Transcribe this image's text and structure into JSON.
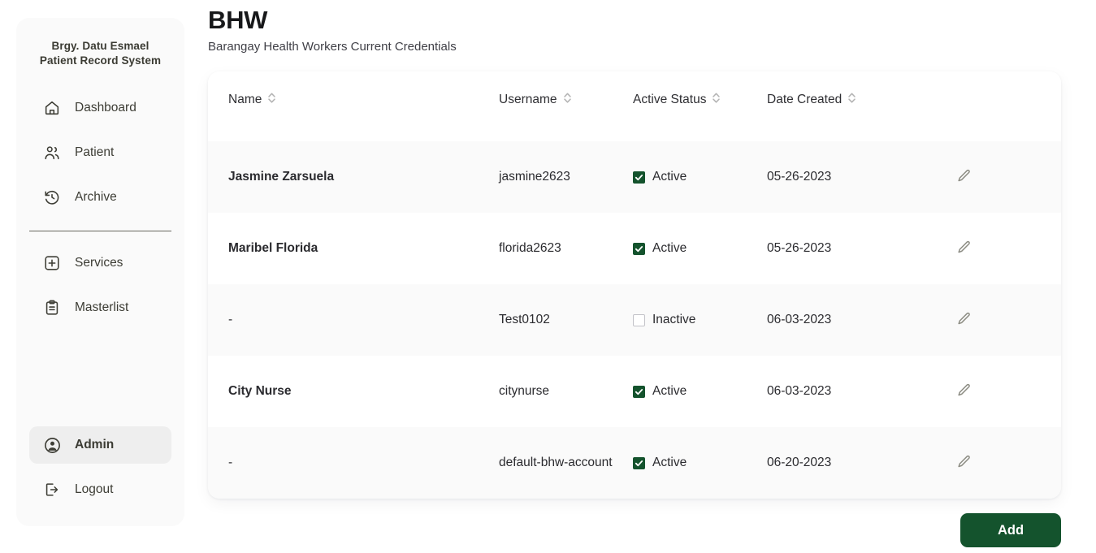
{
  "sidebar": {
    "brand_line1": "Brgy. Datu Esmael",
    "brand_line2": "Patient Record System",
    "top_items": [
      {
        "label": "Dashboard",
        "icon": "home-icon"
      },
      {
        "label": "Patient",
        "icon": "users-icon"
      },
      {
        "label": "Archive",
        "icon": "history-icon"
      }
    ],
    "mid_items": [
      {
        "label": "Services",
        "icon": "medical-cross-icon"
      },
      {
        "label": "Masterlist",
        "icon": "clipboard-icon"
      }
    ],
    "bottom_items": [
      {
        "label": "Admin",
        "icon": "account-circle-icon",
        "active": true
      },
      {
        "label": "Logout",
        "icon": "logout-icon",
        "active": false
      }
    ]
  },
  "header": {
    "title": "BHW",
    "subtitle": "Barangay Health Workers Current Credentials"
  },
  "table": {
    "columns": [
      {
        "label": "Name",
        "sortable": true
      },
      {
        "label": "Username",
        "sortable": true
      },
      {
        "label": "Active Status",
        "sortable": true
      },
      {
        "label": "Date Created",
        "sortable": true
      }
    ],
    "rows": [
      {
        "name": "Jasmine Zarsuela",
        "username": "jasmine2623",
        "status_label": "Active",
        "status_checked": true,
        "date_created": "05-26-2023",
        "action_icon": "pencil-icon"
      },
      {
        "name": "Maribel Florida",
        "username": "florida2623",
        "status_label": "Active",
        "status_checked": true,
        "date_created": "05-26-2023",
        "action_icon": "pencil-icon"
      },
      {
        "name": "-",
        "username": "Test0102",
        "status_label": "Inactive",
        "status_checked": false,
        "date_created": "06-03-2023",
        "action_icon": "pencil-icon"
      },
      {
        "name": "City Nurse",
        "username": "citynurse",
        "status_label": "Active",
        "status_checked": true,
        "date_created": "06-03-2023",
        "action_icon": "pencil-icon"
      },
      {
        "name": "-",
        "username": "default-bhw-account",
        "status_label": "Active",
        "status_checked": true,
        "date_created": "06-20-2023",
        "action_icon": "pencil-icon"
      }
    ]
  },
  "footer": {
    "add_label": "Add"
  },
  "colors": {
    "accent_green": "#14532d",
    "sidebar_bg": "#fafafa",
    "active_pill": "#eeeeee",
    "row_alt_bg": "#fafafa",
    "text_primary": "#1d1d20"
  }
}
